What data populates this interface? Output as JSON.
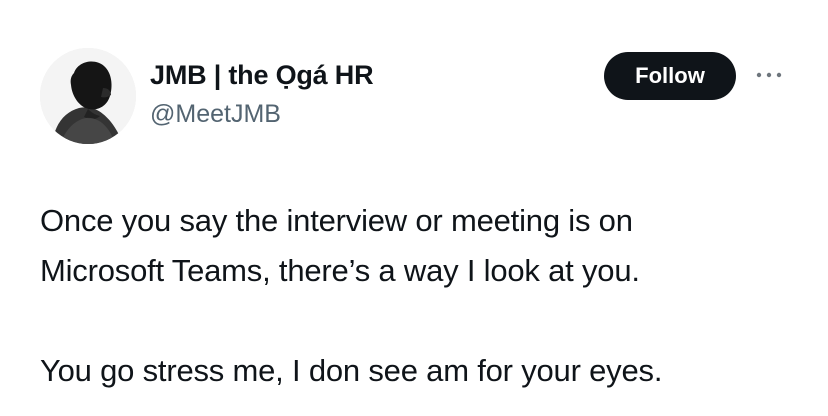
{
  "tweet": {
    "author": {
      "display_name": "JMB | the Ọgá HR",
      "handle": "@MeetJMB",
      "avatar_icon": "profile-silhouette-icon"
    },
    "actions": {
      "follow_label": "Follow",
      "more_icon": "more-horizontal-icon"
    },
    "text": {
      "line_1": "Once you say the interview or meeting is on",
      "line_2": "Microsoft Teams, there’s a way I look at you.",
      "line_3": "You go stress me, I don see am for your eyes."
    },
    "colors": {
      "text_primary": "#0f1419",
      "text_secondary": "#536471",
      "follow_background": "#0f1419",
      "follow_text": "#ffffff",
      "background": "#ffffff"
    }
  }
}
